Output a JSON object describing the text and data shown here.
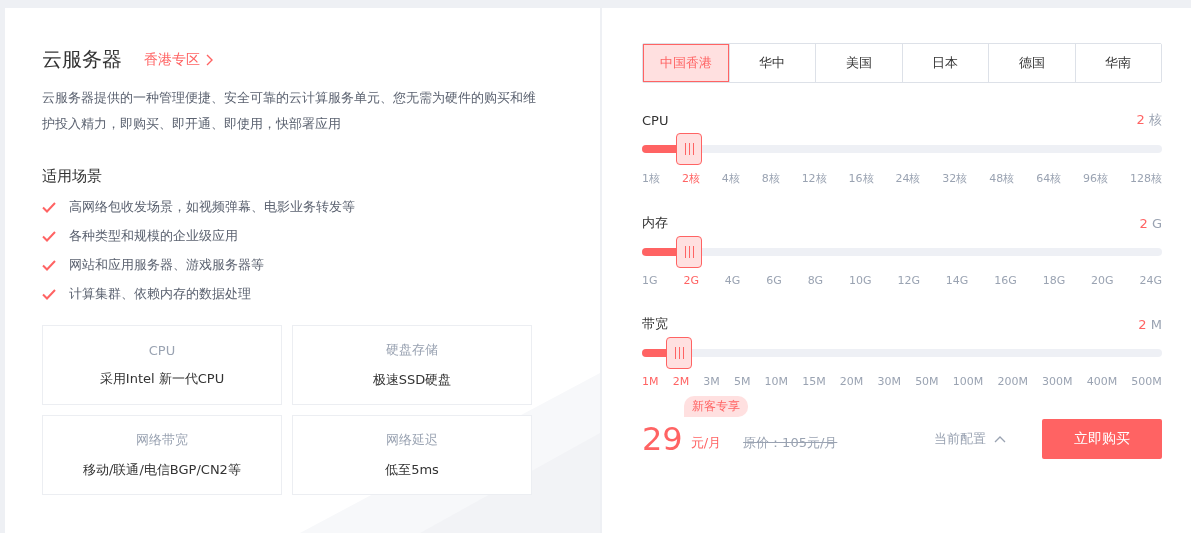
{
  "product": {
    "title": "云服务器",
    "region_link": "香港专区",
    "description": "云服务器提供的一种管理便捷、安全可靠的云计算服务单元、您无需为硬件的购买和维护投入精力，即购买、即开通、即使用，快部署应用"
  },
  "scenarios": {
    "heading": "适用场景",
    "items": [
      "高网络包收发场景，如视频弹幕、电影业务转发等",
      "各种类型和规模的企业级应用",
      "网站和应用服务器、游戏服务器等",
      "计算集群、依赖内存的数据处理"
    ]
  },
  "features": [
    {
      "label": "CPU",
      "value": "采用Intel 新一代CPU"
    },
    {
      "label": "硬盘存储",
      "value": "极速SSD硬盘"
    },
    {
      "label": "网络带宽",
      "value": "移动/联通/电信BGP/CN2等"
    },
    {
      "label": "网络延迟",
      "value": "低至5ms"
    }
  ],
  "region_tabs": [
    {
      "label": "中国香港",
      "selected": true
    },
    {
      "label": "华中",
      "selected": false
    },
    {
      "label": "美国",
      "selected": false
    },
    {
      "label": "日本",
      "selected": false
    },
    {
      "label": "德国",
      "selected": false
    },
    {
      "label": "华南",
      "selected": false
    }
  ],
  "sliders": [
    {
      "label": "CPU",
      "value": "2",
      "unit": "核",
      "level": 0.0909,
      "ticks": [
        {
          "label": "1核",
          "highlighted": false
        },
        {
          "label": "2核",
          "highlighted": true
        },
        {
          "label": "4核",
          "highlighted": false
        },
        {
          "label": "8核",
          "highlighted": false
        },
        {
          "label": "12核",
          "highlighted": false
        },
        {
          "label": "16核",
          "highlighted": false
        },
        {
          "label": "24核",
          "highlighted": false
        },
        {
          "label": "32核",
          "highlighted": false
        },
        {
          "label": "48核",
          "highlighted": false
        },
        {
          "label": "64核",
          "highlighted": false
        },
        {
          "label": "96核",
          "highlighted": false
        },
        {
          "label": "128核",
          "highlighted": false
        }
      ]
    },
    {
      "label": "内存",
      "value": "2",
      "unit": "G",
      "level": 0.0909,
      "ticks": [
        {
          "label": "1G",
          "highlighted": false
        },
        {
          "label": "2G",
          "highlighted": true
        },
        {
          "label": "4G",
          "highlighted": false
        },
        {
          "label": "6G",
          "highlighted": false
        },
        {
          "label": "8G",
          "highlighted": false
        },
        {
          "label": "10G",
          "highlighted": false
        },
        {
          "label": "12G",
          "highlighted": false
        },
        {
          "label": "14G",
          "highlighted": false
        },
        {
          "label": "16G",
          "highlighted": false
        },
        {
          "label": "18G",
          "highlighted": false
        },
        {
          "label": "20G",
          "highlighted": false
        },
        {
          "label": "24G",
          "highlighted": false
        }
      ]
    },
    {
      "label": "带宽",
      "value": "2",
      "unit": "M",
      "level": 0.072,
      "ticks": [
        {
          "label": "1M",
          "highlighted": true
        },
        {
          "label": "2M",
          "highlighted": true
        },
        {
          "label": "3M",
          "highlighted": false
        },
        {
          "label": "5M",
          "highlighted": false
        },
        {
          "label": "10M",
          "highlighted": false
        },
        {
          "label": "15M",
          "highlighted": false
        },
        {
          "label": "20M",
          "highlighted": false
        },
        {
          "label": "30M",
          "highlighted": false
        },
        {
          "label": "50M",
          "highlighted": false
        },
        {
          "label": "100M",
          "highlighted": false
        },
        {
          "label": "200M",
          "highlighted": false
        },
        {
          "label": "300M",
          "highlighted": false
        },
        {
          "label": "400M",
          "highlighted": false
        },
        {
          "label": "500M",
          "highlighted": false
        }
      ]
    }
  ],
  "pricing": {
    "badge": "新客专享",
    "price": "29",
    "price_unit": "元/月",
    "original_price": "原价：105元/月",
    "config_toggle": "当前配置",
    "buy_button": "立即购买"
  }
}
